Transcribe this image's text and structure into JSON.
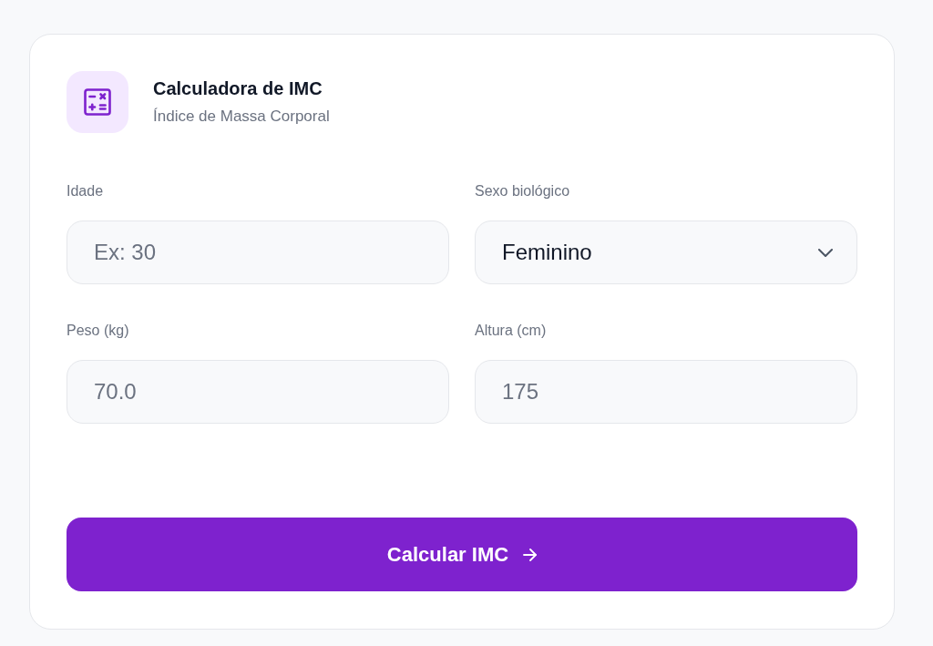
{
  "header": {
    "title": "Calculadora de IMC",
    "subtitle": "Índice de Massa Corporal"
  },
  "fields": [
    {
      "kind": "input",
      "label": "Idade",
      "placeholder": "Ex: 30"
    },
    {
      "kind": "select",
      "label": "Sexo biológico",
      "value": "Feminino"
    },
    {
      "kind": "input",
      "label": "Peso (kg)",
      "placeholder": "70.0"
    },
    {
      "kind": "input",
      "label": "Altura (cm)",
      "placeholder": "175"
    }
  ],
  "submit_button": {
    "label": "Calcular IMC"
  }
}
